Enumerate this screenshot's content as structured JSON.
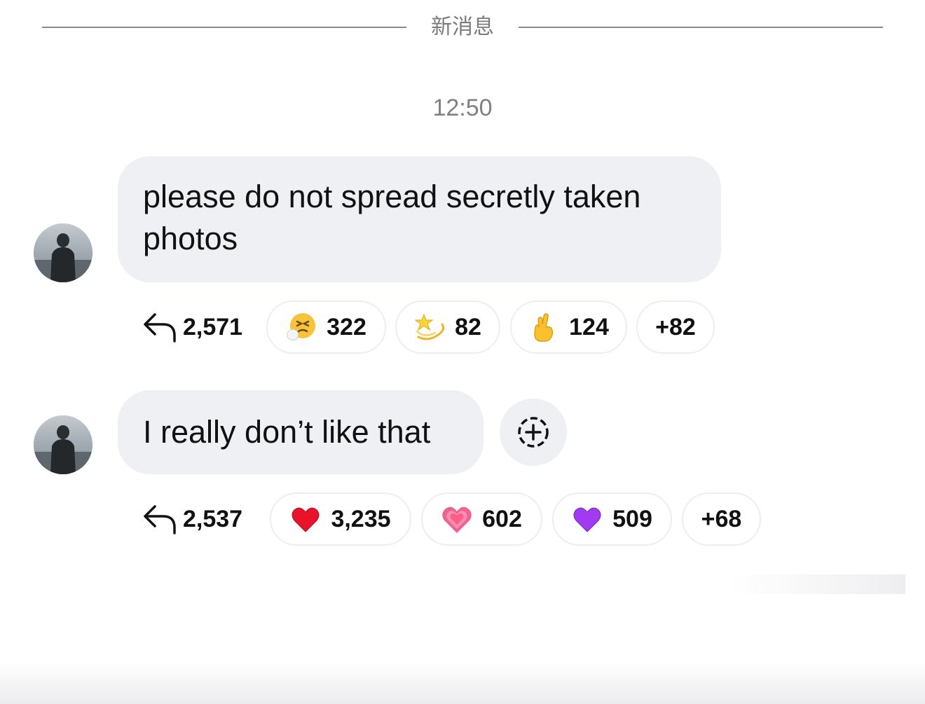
{
  "divider": {
    "label": "新消息"
  },
  "timestamp": "12:50",
  "messages": [
    {
      "text_line1": "please do not spread secretly taken",
      "text_line2": "photos",
      "reply_count": "2,571",
      "reactions": [
        {
          "icon": "sneezing-face-icon",
          "count": "322"
        },
        {
          "icon": "dizzy-star-icon",
          "count": "82"
        },
        {
          "icon": "crossed-fingers-icon",
          "count": "124"
        }
      ],
      "more": "+82"
    },
    {
      "text": "I really don’t like that",
      "reply_count": "2,537",
      "reactions": [
        {
          "icon": "red-heart-icon",
          "count": "3,235"
        },
        {
          "icon": "growing-heart-icon",
          "count": "602"
        },
        {
          "icon": "purple-heart-icon",
          "count": "509"
        }
      ],
      "more": "+68"
    }
  ],
  "colors": {
    "bubble": "#eff0f4",
    "divider": "#8a8a8e",
    "pill_border": "#eceef1"
  }
}
